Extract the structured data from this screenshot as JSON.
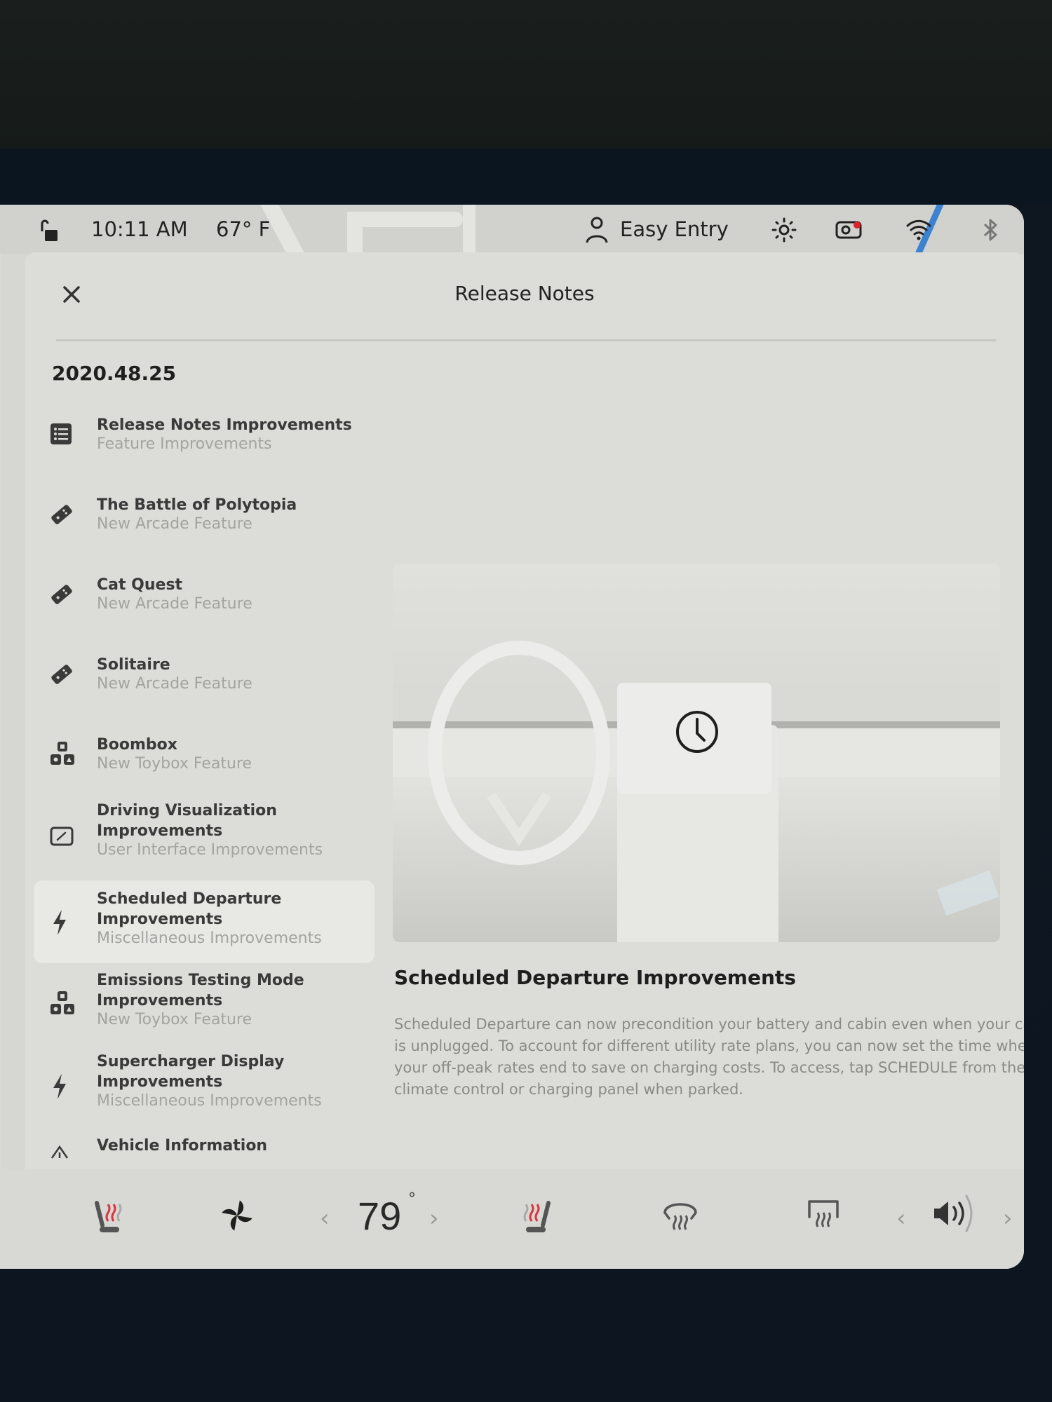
{
  "status_bar": {
    "lock_icon": "unlocked-icon",
    "time": "10:11 AM",
    "temperature": "67° F",
    "profile_label": "Easy Entry",
    "icons": [
      "person-icon",
      "sentry-mode-icon",
      "dashcam-icon",
      "wifi-icon",
      "bluetooth-icon"
    ],
    "dashcam_dot_color": "#e0202a",
    "map_route_color": "#3b82d0"
  },
  "modal": {
    "title": "Release Notes",
    "close_icon": "close-icon",
    "version": "2020.48.25",
    "items": [
      {
        "title": "Release Notes Improvements",
        "subtitle": "Feature Improvements",
        "icon": "list-icon",
        "selected": false
      },
      {
        "title": "The Battle of Polytopia",
        "subtitle": "New Arcade Feature",
        "icon": "gamepad-icon",
        "selected": false
      },
      {
        "title": "Cat Quest",
        "subtitle": "New Arcade Feature",
        "icon": "gamepad-icon",
        "selected": false
      },
      {
        "title": "Solitaire",
        "subtitle": "New Arcade Feature",
        "icon": "gamepad-icon",
        "selected": false
      },
      {
        "title": "Boombox",
        "subtitle": "New Toybox Feature",
        "icon": "toybox-icon",
        "selected": false
      },
      {
        "title": "Driving Visualization Improvements",
        "subtitle": "User Interface Improvements",
        "icon": "display-icon",
        "selected": false
      },
      {
        "title": "Scheduled Departure Improvements",
        "subtitle": "Miscellaneous Improvements",
        "icon": "bolt-icon",
        "selected": true
      },
      {
        "title": "Emissions Testing Mode Improvements",
        "subtitle": "New Toybox Feature",
        "icon": "toybox-icon",
        "selected": false
      },
      {
        "title": "Supercharger Display Improvements",
        "subtitle": "Miscellaneous Improvements",
        "icon": "bolt-icon",
        "selected": false
      },
      {
        "title": "Vehicle Information",
        "subtitle": "",
        "icon": "vehicle-icon",
        "selected": false
      }
    ],
    "detail": {
      "image_icon": "clock-icon",
      "title": "Scheduled Departure Improvements",
      "body": "Scheduled Departure can now precondition your battery and cabin even when your car is unplugged. To account for different utility rate plans, you can now set the time when your off-peak rates end to save on charging costs. To access, tap SCHEDULE from the climate control or charging panel when parked."
    }
  },
  "bottom_bar": {
    "driver_seat_heater_icon": "seat-heater-left-icon",
    "fan_icon": "fan-icon",
    "temperature": "79",
    "degree_symbol": "°",
    "temp_down": "‹",
    "temp_up": "›",
    "passenger_seat_heater_icon": "seat-heater-right-icon",
    "front_defrost_icon": "front-defrost-icon",
    "rear_defrost_icon": "rear-defrost-icon",
    "volume_down": "‹",
    "volume_up": "›",
    "volume_icon": "speaker-icon",
    "heater_color": "#d9363e"
  }
}
